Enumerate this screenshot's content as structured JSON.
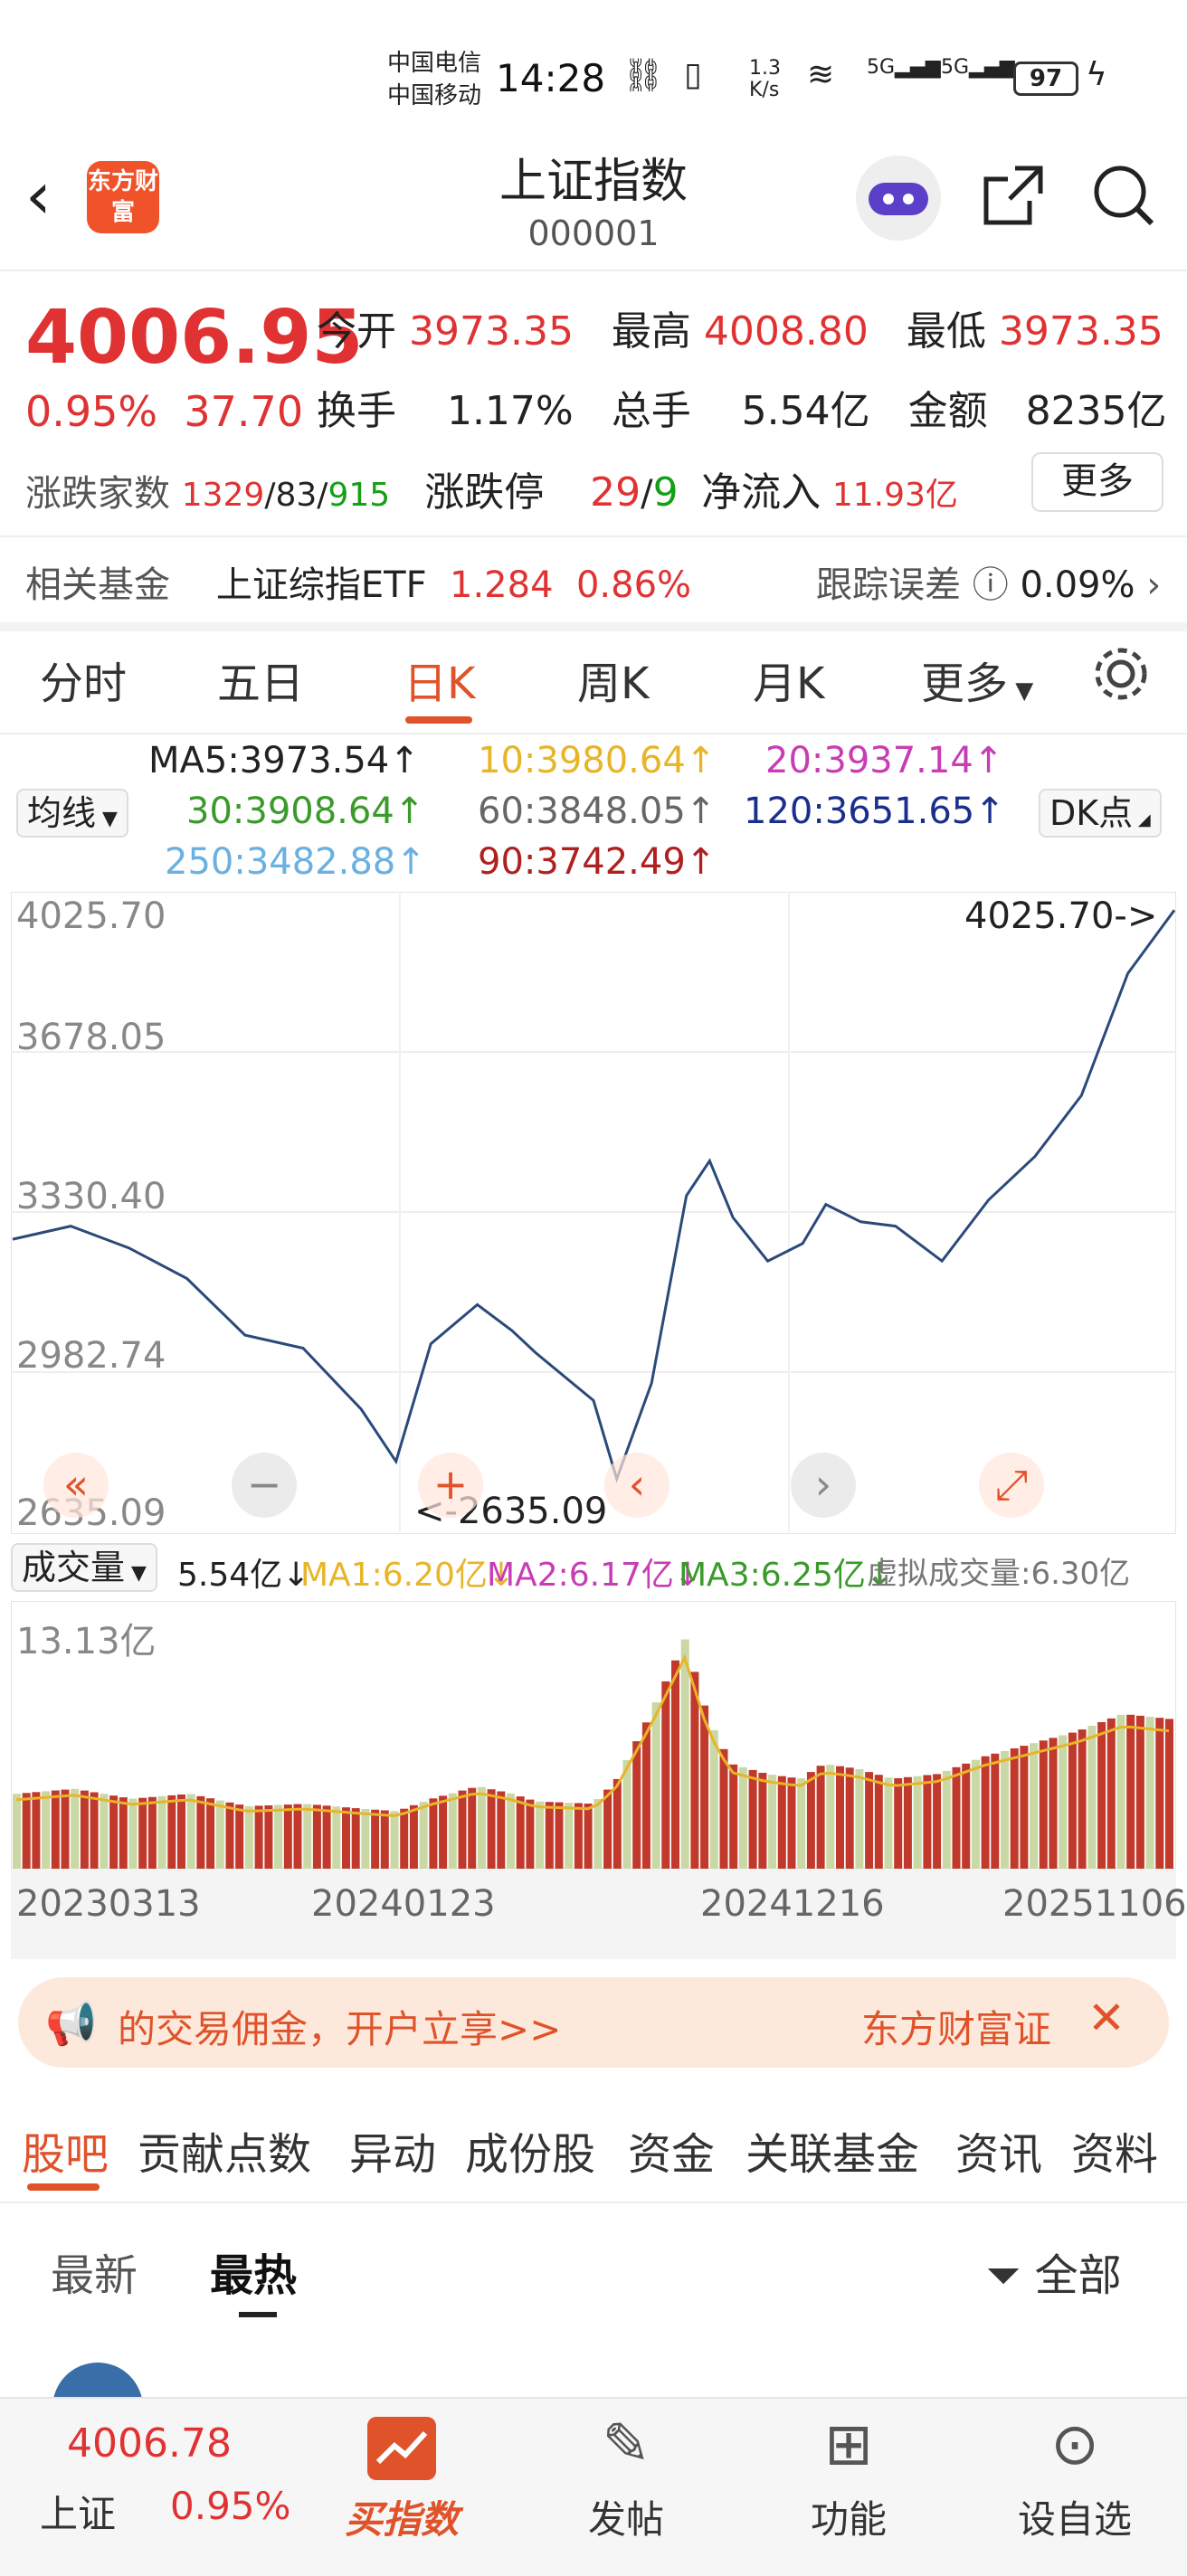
{
  "status": {
    "carrier1": "中国电信",
    "carrier2": "中国移动",
    "time": "14:28",
    "speed_value": "1.3",
    "speed_unit": "K/s",
    "net1": "5G",
    "net2": "5G",
    "battery": "97"
  },
  "header": {
    "logo": "东方财富",
    "title": "上证指数",
    "code": "000001"
  },
  "quote": {
    "price": "4006.95",
    "pct": "0.95%",
    "change": "37.70",
    "open_label": "今开",
    "open": "3973.35",
    "high_label": "最高",
    "high": "4008.80",
    "low_label": "最低",
    "low": "3973.35",
    "turnover_label": "换手",
    "turnover": "1.17%",
    "hands_label": "总手",
    "hands": "5.54亿",
    "amount_label": "金额",
    "amount": "8235亿",
    "breadth_label": "涨跌家数",
    "breadth_up": "1329",
    "breadth_flat": "83",
    "breadth_down": "915",
    "limit_label": "涨跌停",
    "limit_up": "29",
    "limit_down": "9",
    "inflow_label": "净流入",
    "inflow": "11.93亿",
    "more": "更多"
  },
  "fund": {
    "label": "相关基金",
    "name": "上证综指ETF",
    "price": "1.284",
    "pct": "0.86%",
    "track_label": "跟踪误差",
    "track": "0.09%"
  },
  "tabs": [
    "分时",
    "五日",
    "日K",
    "周K",
    "月K",
    "更多"
  ],
  "ma": {
    "type": "均线",
    "ma5": "MA5:3973.54",
    "ma10": "10:3980.64",
    "ma20": "20:3937.14",
    "ma30": "30:3908.64",
    "ma60": "60:3848.05",
    "ma120": "120:3651.65",
    "ma250": "250:3482.88",
    "ma90": "90:3742.49",
    "dk": "DK点"
  },
  "vol": {
    "type": "成交量",
    "v": "5.54亿",
    "ma1": "MA1:6.20亿",
    "ma2": "MA2:6.17亿",
    "ma3": "MA3:6.25亿",
    "virtual": "虚拟成交量:6.30亿",
    "ymax": "13.13亿"
  },
  "colors": {
    "up": "#e03232",
    "down": "#14a014",
    "accent": "#e0532a",
    "line": "#2b4a7a",
    "ma10": "#e8b428",
    "ma20": "#c83cb4",
    "ma30": "#3a9a2a",
    "ma60": "#666666",
    "ma120": "#1a2f8c",
    "ma250": "#6ab0e0",
    "ma90": "#b02020"
  },
  "chart_data": {
    "type": "line",
    "title": "",
    "y_ticks": [
      "4025.70",
      "3678.05",
      "3330.40",
      "2982.74",
      "2635.09"
    ],
    "ylim": [
      2635.09,
      4025.7
    ],
    "max_label": "4025.70->",
    "min_label": "<-2635.09",
    "x_ticks": [
      "20230313",
      "20240123",
      "20241216",
      "20251106"
    ],
    "x": [
      0,
      0.05,
      0.1,
      0.15,
      0.2,
      0.25,
      0.3,
      0.33,
      0.36,
      0.4,
      0.43,
      0.45,
      0.5,
      0.52,
      0.55,
      0.58,
      0.6,
      0.62,
      0.65,
      0.68,
      0.7,
      0.73,
      0.76,
      0.8,
      0.84,
      0.88,
      0.92,
      0.96,
      1.0
    ],
    "values": [
      3270,
      3300,
      3250,
      3180,
      3050,
      3020,
      2880,
      2760,
      3030,
      3120,
      3060,
      3010,
      2900,
      2720,
      2940,
      3370,
      3450,
      3320,
      3220,
      3260,
      3350,
      3310,
      3300,
      3220,
      3360,
      3460,
      3600,
      3880,
      4025
    ],
    "volume": [
      0.3,
      0.32,
      0.28,
      0.3,
      0.25,
      0.26,
      0.24,
      0.23,
      0.28,
      0.33,
      0.3,
      0.27,
      0.26,
      0.35,
      0.62,
      0.92,
      0.6,
      0.42,
      0.38,
      0.36,
      0.42,
      0.4,
      0.36,
      0.38,
      0.45,
      0.5,
      0.55,
      0.62,
      0.6
    ]
  },
  "banner": {
    "text": "的交易佣金，开户立享>>",
    "brand": "东方财富证"
  },
  "btabs": [
    "股吧",
    "贡献点数",
    "异动",
    "成份股",
    "资金",
    "关联基金",
    "资讯",
    "资料"
  ],
  "sub": {
    "latest": "最新",
    "hot": "最热",
    "all": "全部"
  },
  "nav": {
    "price": "4006.78",
    "name": "上证",
    "pct": "0.95%",
    "buy": "买指数",
    "post": "发帖",
    "func": "功能",
    "watch": "设自选"
  }
}
